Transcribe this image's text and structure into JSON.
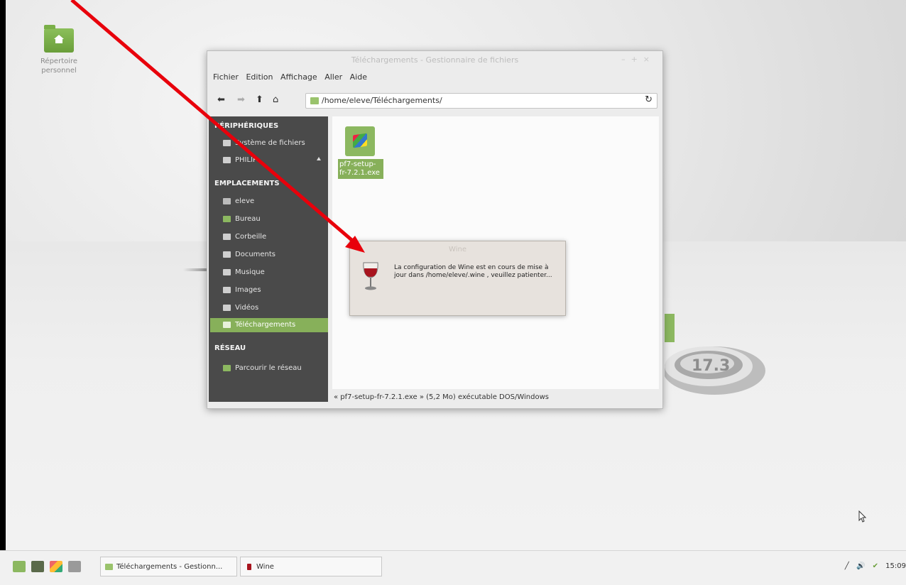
{
  "desktop": {
    "home_icon_label_line1": "Répertoire",
    "home_icon_label_line2": "personnel"
  },
  "file_manager": {
    "title": "Téléchargements - Gestionnaire de fichiers",
    "menu": [
      "Fichier",
      "Edition",
      "Affichage",
      "Aller",
      "Aide"
    ],
    "location_path": "/home/eleve/Téléchargements/",
    "sidebar": {
      "devices_header": "PÉRIPHÉRIQUES",
      "devices": [
        "Système de fichiers",
        "PHILIP"
      ],
      "places_header": "EMPLACEMENTS",
      "places": [
        "eleve",
        "Bureau",
        "Corbeille",
        "Documents",
        "Musique",
        "Images",
        "Vidéos",
        "Téléchargements"
      ],
      "network_header": "RÉSEAU",
      "network": [
        "Parcourir le réseau"
      ]
    },
    "file": {
      "name_line1": "pf7-setup-",
      "name_line2": "fr-7.2.1.exe"
    },
    "status": "« pf7-setup-fr-7.2.1.exe » (5,2 Mo) exécutable DOS/Windows"
  },
  "wine_dialog": {
    "title": "Wine",
    "message": "La configuration de Wine est en cours de mise à jour dans /home/eleve/.wine , veuillez patienter..."
  },
  "taskbar": {
    "tasks": [
      "Téléchargements - Gestionn...",
      "Wine"
    ],
    "clock": "15:09"
  },
  "colors": {
    "accent": "#87b05a",
    "arrow": "#e8000b",
    "sidebar_bg": "#4a4a4a"
  }
}
